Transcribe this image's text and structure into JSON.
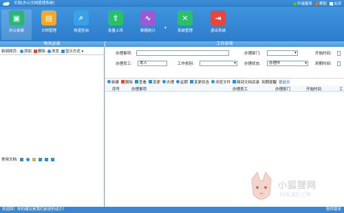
{
  "app": {
    "title": "文软[办公文档管理系统]"
  },
  "top_links": [
    {
      "label": "升级服务",
      "color": "#52c41a"
    },
    {
      "label": "帮助",
      "color": "#ff6a00"
    },
    {
      "label": "关闭",
      "color": "#ffffff"
    }
  ],
  "toolbar": {
    "items": [
      {
        "label": "办公桌面",
        "icon": "desktop-icon",
        "color": "#2bb673"
      },
      {
        "label": "文档管理",
        "icon": "folder-icon",
        "color": "#f0a92e"
      },
      {
        "label": "快速查询",
        "icon": "search-icon",
        "color": "#3aa0e8"
      },
      {
        "label": "批量上传",
        "icon": "upload-icon",
        "color": "#2bbf6a"
      },
      {
        "label": "数据统计",
        "icon": "chart-icon",
        "color": "#9b59d6"
      },
      {
        "label": "系统管理",
        "icon": "tools-icon",
        "color": "#2bbf6a"
      },
      {
        "label": "退出系统",
        "icon": "exit-icon",
        "color": "#e8453c"
      }
    ],
    "dropdown": "▾"
  },
  "left": {
    "title": "每天必读",
    "row1_label": "新闻网页:",
    "row1_actions": [
      {
        "label": "添加",
        "color": "#2b8fe0"
      },
      {
        "label": "删除",
        "color": "#e04b2b"
      },
      {
        "label": "浏览",
        "color": "#2b8fe0"
      },
      {
        "label": "显示方式",
        "color": "#2b8fe0"
      }
    ],
    "row2_label": "常用文档:"
  },
  "right": {
    "title": "工作安排",
    "form": {
      "task_label": "办理事项:",
      "task_value": "",
      "dept_label": "办理部门:",
      "dept_value": "",
      "start_label": "开始时间:",
      "staff_label": "办理员工:",
      "staff_value": "本人",
      "type_label": "工作类别:",
      "type_value": "",
      "status_label": "办理状态:",
      "status_value": "办理中",
      "due_label": "到期时间:"
    },
    "actions": [
      {
        "label": "新建",
        "color": "#2b8fe0"
      },
      {
        "label": "删除",
        "color": "#e04b2b"
      },
      {
        "label": "查看",
        "color": "#2b8fe0"
      },
      {
        "label": "变更",
        "color": "#2b8fe0"
      },
      {
        "label": "办理",
        "color": "#2b8fe0"
      },
      {
        "label": "延期",
        "color": "#2b8fe0"
      },
      {
        "label": "变更状态",
        "color": "#2b8fe0"
      },
      {
        "label": "浏览文件",
        "color": "#2b8fe0"
      },
      {
        "label": "跨到文档目录",
        "color": "#2b8fe0"
      },
      {
        "label": "到期提醒",
        "color": "#2b8fe0"
      },
      {
        "label": "提前天",
        "color": "#2b8fe0"
      }
    ],
    "columns": [
      "序号",
      "办理事项",
      "办理员工",
      "办理部门",
      "开始时间",
      "工"
    ]
  },
  "status": {
    "left": "欢迎回！你的建议是我们前进的动力！",
    "right": "软件版本"
  },
  "watermark": {
    "cn": "小狐狸网",
    "en": "XHLKS.CN"
  }
}
